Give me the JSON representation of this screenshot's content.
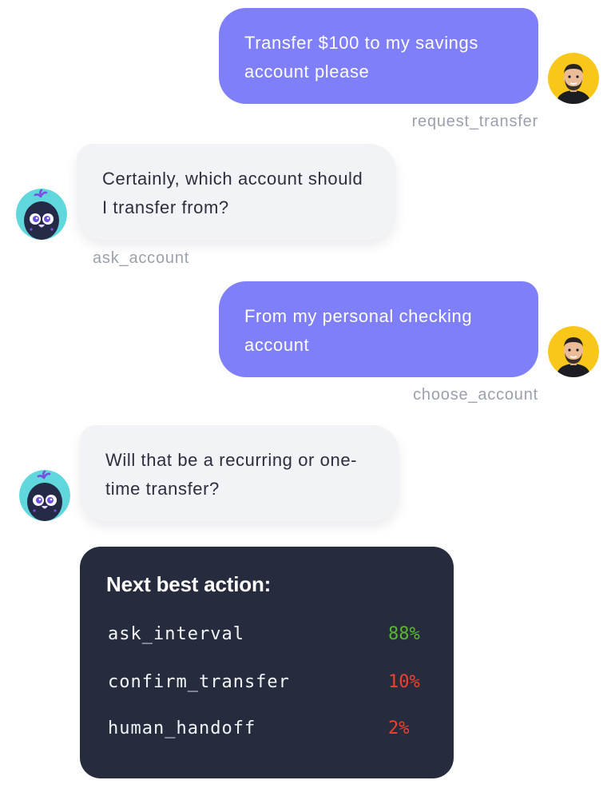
{
  "conversation": {
    "messages": [
      {
        "role": "user",
        "text": "Transfer $100 to my savings account please",
        "intent": "request_transfer"
      },
      {
        "role": "bot",
        "text": "Certainly, which account should I transfer from?",
        "intent": "ask_account"
      },
      {
        "role": "user",
        "text": "From my personal checking account",
        "intent": "choose_account"
      },
      {
        "role": "bot",
        "text": "Will that be a recurring or one-time transfer?"
      }
    ]
  },
  "next_best_action": {
    "title": "Next best action:",
    "options": [
      {
        "label": "ask_interval",
        "percent": "88%",
        "color": "#5ab82e"
      },
      {
        "label": "confirm_transfer",
        "percent": "10%",
        "color": "#f0402e"
      },
      {
        "label": "human_handoff",
        "percent": "2%",
        "color": "#f0402e"
      }
    ]
  },
  "colors": {
    "user_bubble": "#7f7ffa",
    "bot_bubble": "#f2f3f7",
    "panel": "#262c3d",
    "user_avatar_bg": "#f8c71a",
    "bot_avatar_bg": "#5fd7dc"
  },
  "icons": {
    "user_avatar": "user-avatar-icon",
    "bot_avatar": "bot-avatar-icon"
  }
}
